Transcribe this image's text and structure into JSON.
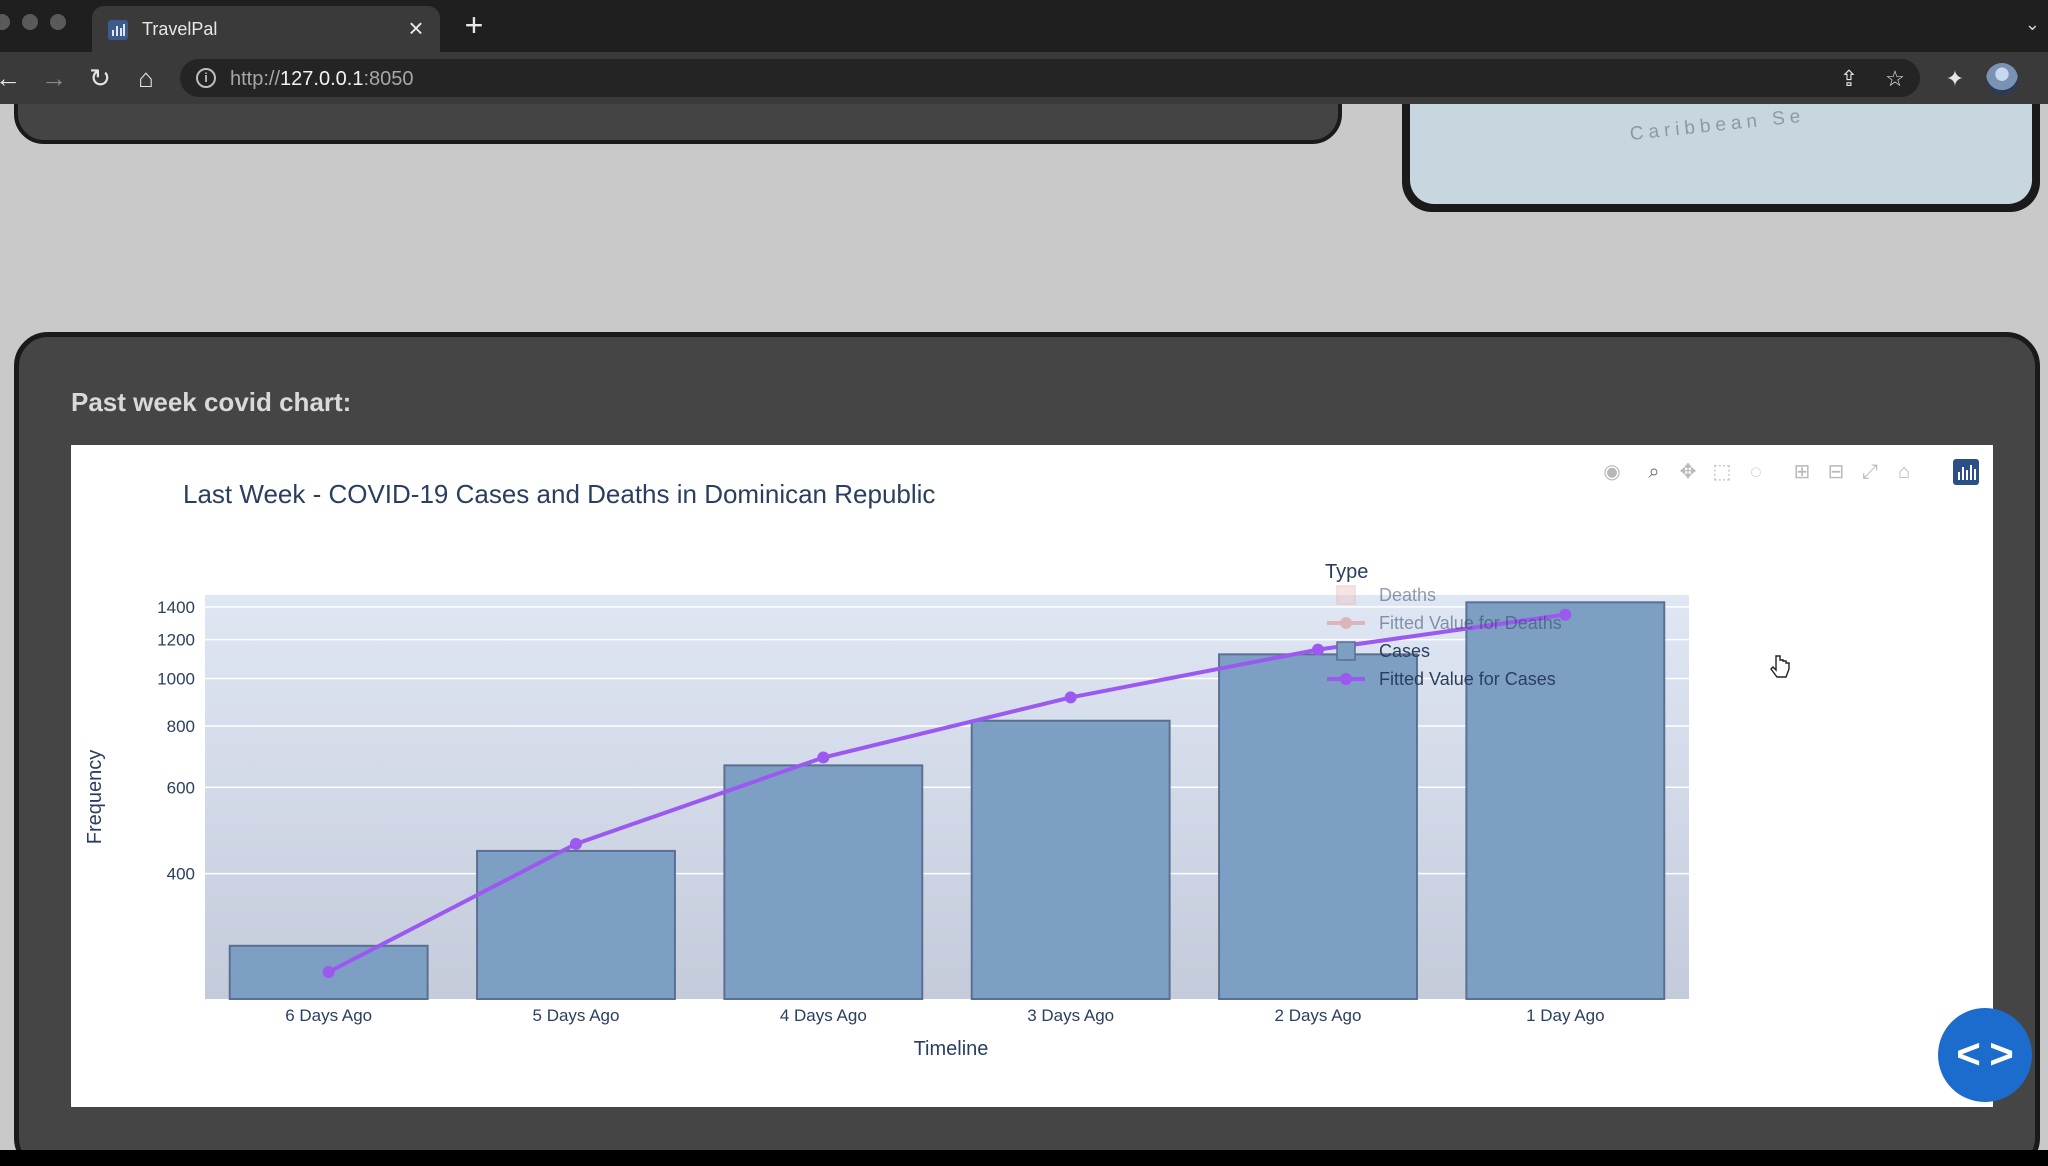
{
  "browser": {
    "tab_title": "TravelPal",
    "url_scheme": "http://",
    "url_host": "127.0.0.1",
    "url_port": ":8050"
  },
  "map": {
    "label": "Caribbean Se"
  },
  "section": {
    "heading": "Past week covid chart:"
  },
  "icons": {
    "back": "arrow-left-icon",
    "forward": "arrow-right-icon",
    "reload": "reload-icon",
    "home": "home-icon",
    "share": "share-icon",
    "bookmark": "star-icon",
    "extensions": "puzzle-icon",
    "modebar": [
      "camera-icon",
      "zoom-icon",
      "pan-icon",
      "box-select-icon",
      "lasso-icon",
      "zoom-in-icon",
      "zoom-out-icon",
      "autoscale-icon",
      "reset-axes-icon",
      "plotly-logo-icon"
    ]
  },
  "colors": {
    "bar_fill": "#7e9fc4",
    "bar_stroke": "#5a6f92",
    "fitted_cases": "#9b59f0",
    "fitted_deaths": "#d98a86",
    "deaths_swatch": "#eecaca",
    "accent_fab": "#1b6ccc"
  },
  "chart_data": {
    "type": "bar",
    "title": "Last Week - COVID-19 Cases and Deaths in Dominican Republic",
    "xlabel": "Timeline",
    "ylabel": "Frequency",
    "y_scale": "log",
    "ylim": [
      222,
      1480
    ],
    "y_ticks": [
      400,
      600,
      800,
      1000,
      1200,
      1400
    ],
    "categories": [
      "6 Days Ago",
      "5 Days Ago",
      "4 Days Ago",
      "3 Days Ago",
      "2 Days Ago",
      "1 Day Ago"
    ],
    "legend_title": "Type",
    "legend_placement": "right",
    "series": [
      {
        "name": "Deaths",
        "kind": "bar",
        "hidden": true,
        "values": []
      },
      {
        "name": "Fitted Value for Deaths",
        "kind": "line",
        "hidden": true,
        "values": []
      },
      {
        "name": "Cases",
        "kind": "bar",
        "hidden": false,
        "values": [
          285,
          445,
          665,
          820,
          1120,
          1430
        ]
      },
      {
        "name": "Fitted Value for Cases",
        "kind": "line",
        "hidden": false,
        "values": [
          252,
          460,
          690,
          915,
          1145,
          1350
        ]
      }
    ]
  }
}
